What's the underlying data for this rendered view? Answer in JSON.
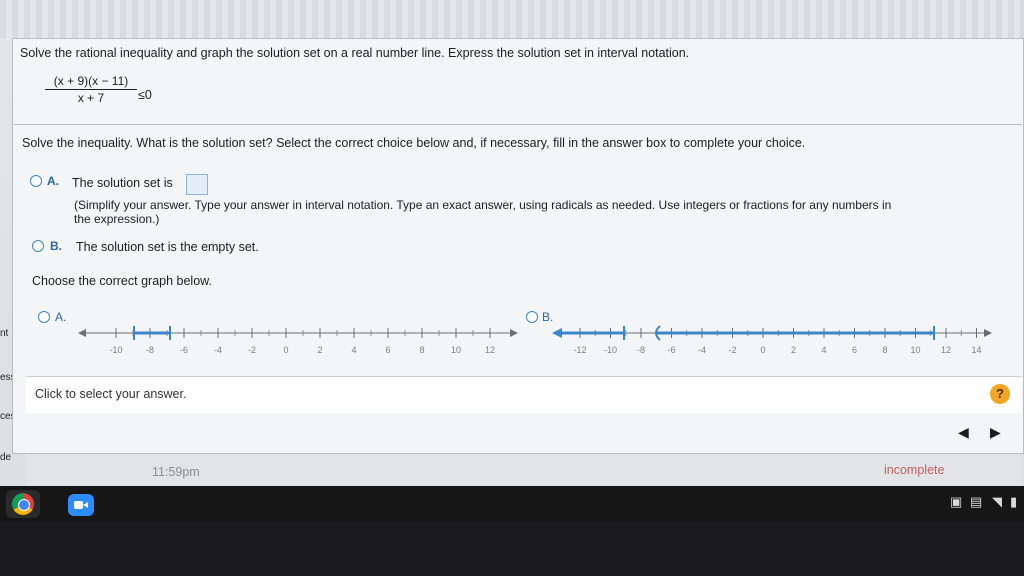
{
  "question": {
    "instruction": "Solve the rational inequality and graph the solution set on a real number line. Express the solution set in interval notation.",
    "numerator": "(x + 9)(x − 11)",
    "denominator": "x + 7",
    "relation": "≤0",
    "prompt": "Solve the inequality. What is the solution set? Select the correct choice below and, if necessary, fill in the answer box to complete your choice."
  },
  "choices": {
    "a_letter": "A.",
    "a_text": "The solution set is",
    "a_hint_line1": "(Simplify your answer. Type your answer in interval notation. Type an exact answer, using radicals as needed. Use integers or fractions for any numbers in",
    "a_hint_line2": "the expression.)",
    "b_letter": "B.",
    "b_text": "The solution set is the empty set."
  },
  "graph_prompt": "Choose the correct graph below.",
  "graph_options": {
    "a_letter": "A.",
    "b_letter": "B.",
    "a_ticks": [
      "-10",
      "-8",
      "-6",
      "-4",
      "-2",
      "0",
      "2",
      "4",
      "6",
      "8",
      "10",
      "12"
    ],
    "b_ticks": [
      "-12",
      "-10",
      "-8",
      "-6",
      "-4",
      "-2",
      "0",
      "2",
      "4",
      "6",
      "8",
      "10",
      "12",
      "14"
    ]
  },
  "answer_bar": {
    "text": "Click to select your answer.",
    "help": "?"
  },
  "footer": {
    "time": "11:59pm",
    "status": "incomplete"
  },
  "left_fragments": [
    "nt",
    "ess",
    "cess",
    "de"
  ],
  "colors": {
    "accent_blue": "#3a86c8",
    "status_text": "#c06060",
    "help_orange": "#f2a623"
  }
}
